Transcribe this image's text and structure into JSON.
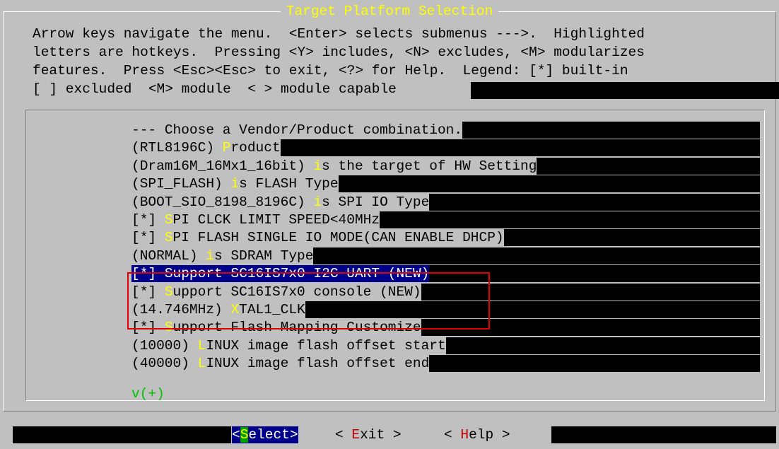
{
  "title": "Target Platform Selection",
  "help_lines": [
    "Arrow keys navigate the menu.  <Enter> selects submenus --->.  Highlighted",
    "letters are hotkeys.  Pressing <Y> includes, <N> excludes, <M> modularizes",
    "features.  Press <Esc><Esc> to exit, <?> for Help.  Legend: [*] built-in",
    "[ ] excluded  <M> module  < > module capable"
  ],
  "menu": {
    "items": [
      {
        "prefix": "--- ",
        "hotkey": "",
        "rest": "Choose a Vendor/Product combination."
      },
      {
        "prefix": "(RTL8196C) ",
        "hotkey": "P",
        "rest": "roduct"
      },
      {
        "prefix": "(Dram16M_16Mx1_16bit) ",
        "hotkey": "i",
        "rest": "s the target of HW Setting"
      },
      {
        "prefix": "(SPI_FLASH) ",
        "hotkey": "i",
        "rest": "s FLASH Type"
      },
      {
        "prefix": "(BOOT_SIO_8198_8196C) ",
        "hotkey": "i",
        "rest": "s SPI IO Type"
      },
      {
        "prefix": "[*] ",
        "hotkey": "S",
        "rest": "PI CLCK LIMIT SPEED<40MHz"
      },
      {
        "prefix": "[*] ",
        "hotkey": "S",
        "rest": "PI FLASH SINGLE IO MODE(CAN ENABLE DHCP)"
      },
      {
        "prefix": "(NORMAL) ",
        "hotkey": "i",
        "rest": "s SDRAM Type"
      },
      {
        "prefix": "[*] ",
        "hotkey": "S",
        "rest": "upport SC16IS7x0 I2C UART (NEW)"
      },
      {
        "prefix": "[*] ",
        "hotkey": "S",
        "rest": "upport SC16IS7x0 console (NEW)"
      },
      {
        "prefix": "(14.746MHz) ",
        "hotkey": "X",
        "rest": "TAL1_CLK"
      },
      {
        "prefix": "[*] ",
        "hotkey": "S",
        "rest": "upport Flash Mapping Customize"
      },
      {
        "prefix": "(10000) ",
        "hotkey": "L",
        "rest": "INUX image flash offset start"
      },
      {
        "prefix": "(40000) ",
        "hotkey": "L",
        "rest": "INUX image flash offset end"
      }
    ],
    "more_indicator": "v(+)",
    "selected_index": 8
  },
  "buttons": {
    "select": {
      "left": "<",
      "key": "S",
      "rest": "elect>"
    },
    "exit": {
      "left": "< ",
      "key": "E",
      "rest": "xit >"
    },
    "help": {
      "left": "< ",
      "key": "H",
      "rest": "elp >"
    }
  },
  "colors": {
    "background": "#c0c0c0",
    "title": "#ffff00",
    "hotkey": "#ffff00",
    "selection": "#00008b",
    "annotation_box": "#e00000",
    "more_indicator": "#00c000"
  }
}
